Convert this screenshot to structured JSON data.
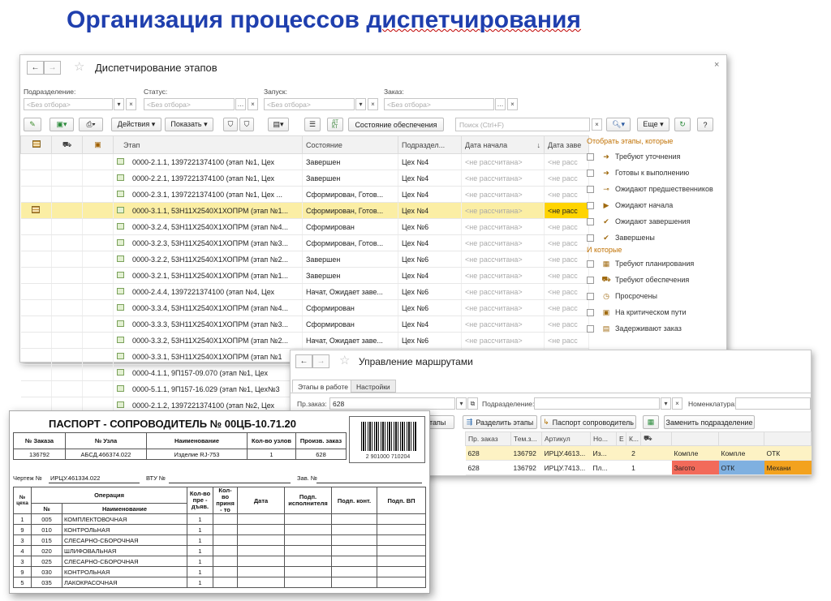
{
  "slide": {
    "title_a": "Организация процессов ",
    "title_b": "диспетчирования"
  },
  "win1": {
    "nav_back": "←",
    "nav_fwd": "→",
    "star": "☆",
    "title": "Диспетчирование этапов",
    "close": "×",
    "filters": [
      {
        "label": "Подразделение:",
        "placeholder": "<Без отбора>"
      },
      {
        "label": "Статус:",
        "placeholder": "<Без отбора>"
      },
      {
        "label": "Запуск:",
        "placeholder": "<Без отбора>"
      },
      {
        "label": "Заказ:",
        "placeholder": "<Без отбора>"
      }
    ],
    "toolbar": {
      "actions": "Действия ▾",
      "show": "Показать ▾",
      "supply_state": "Состояние обеспечения",
      "search_placeholder": "Поиск (Ctrl+F)",
      "more": "Еще ▾",
      "help": "?"
    },
    "columns": [
      "",
      "",
      "",
      "Этап",
      "Состояние",
      "Подраздел...",
      "Дата начала",
      "Дата заве"
    ],
    "sort_arrow": "↓",
    "rows": [
      {
        "stage": "0000-2.1.1, 1397221374100 (этап №1, Цех",
        "state": "Завершен",
        "dept": "Цех №4",
        "start": "<не рассчитана>",
        "end": "<не расс"
      },
      {
        "stage": "0000-2.2.1, 1397221374100 (этап №1, Цех",
        "state": "Завершен",
        "dept": "Цех №4",
        "start": "<не рассчитана>",
        "end": "<не расс"
      },
      {
        "stage": "0000-2.3.1, 1397221374100 (этап №1, Цех ...",
        "state": "Сформирован, Готов...",
        "dept": "Цех №4",
        "start": "<не рассчитана>",
        "end": "<не расс"
      },
      {
        "stage": "0000-3.1.1, 53Н11Х2540Х1ХОПРМ (этап №1...",
        "state": "Сформирован, Готов...",
        "dept": "Цех №4",
        "start": "<не рассчитана>",
        "end": "<не расс"
      },
      {
        "stage": "0000-3.2.4, 53Н11Х2540Х1ХОПРМ (этап №4...",
        "state": "Сформирован",
        "dept": "Цех №6",
        "start": "<не рассчитана>",
        "end": "<не расс"
      },
      {
        "stage": "0000-3.2.3, 53Н11Х2540Х1ХОПРМ (этап №3...",
        "state": "Сформирован, Готов...",
        "dept": "Цех №4",
        "start": "<не рассчитана>",
        "end": "<не расс"
      },
      {
        "stage": "0000-3.2.2, 53Н11Х2540Х1ХОПРМ (этап №2...",
        "state": "Завершен",
        "dept": "Цех №6",
        "start": "<не рассчитана>",
        "end": "<не расс"
      },
      {
        "stage": "0000-3.2.1, 53Н11Х2540Х1ХОПРМ (этап №1...",
        "state": "Завершен",
        "dept": "Цех №4",
        "start": "<не рассчитана>",
        "end": "<не расс"
      },
      {
        "stage": "0000-2.4.4, 1397221374100 (этап №4, Цех",
        "state": "Начат, Ожидает заве...",
        "dept": "Цех №6",
        "start": "<не рассчитана>",
        "end": "<не расс"
      },
      {
        "stage": "0000-3.3.4, 53Н11Х2540Х1ХОПРМ (этап №4...",
        "state": "Сформирован",
        "dept": "Цех №6",
        "start": "<не рассчитана>",
        "end": "<не расс"
      },
      {
        "stage": "0000-3.3.3, 53Н11Х2540Х1ХОПРМ (этап №3...",
        "state": "Сформирован",
        "dept": "Цех №4",
        "start": "<не рассчитана>",
        "end": "<не расс"
      },
      {
        "stage": "0000-3.3.2, 53Н11Х2540Х1ХОПРМ (этап №2...",
        "state": "Начат, Ожидает заве...",
        "dept": "Цех №6",
        "start": "<не рассчитана>",
        "end": "<не расс"
      },
      {
        "stage": "0000-3.3.1, 53Н11Х2540Х1ХОПРМ (этап №1",
        "state": "",
        "dept": "",
        "start": "",
        "end": ""
      },
      {
        "stage": "0000-4.1.1, 9П157-09.070 (этап №1, Цех",
        "state": "",
        "dept": "",
        "start": "",
        "end": ""
      },
      {
        "stage": "0000-5.1.1, 9П157-16.029 (этап №1, Цех№3",
        "state": "",
        "dept": "",
        "start": "",
        "end": ""
      },
      {
        "stage": "0000-2.1.2, 1397221374100 (этап №2, Цех",
        "state": "",
        "dept": "",
        "start": "",
        "end": ""
      }
    ],
    "selected_end": "<не расс",
    "side_panel": {
      "header1": "Отобрать этапы, которые",
      "items1": [
        {
          "icon": "➜",
          "label": "Требуют уточнения"
        },
        {
          "icon": "➜",
          "label": "Готовы к выполнению"
        },
        {
          "icon": "⊸",
          "label": "Ожидают предшественников"
        },
        {
          "icon": "▶",
          "label": "Ожидают начала"
        },
        {
          "icon": "✔",
          "label": "Ожидают завершения"
        },
        {
          "icon": "✔",
          "label": "Завершены"
        }
      ],
      "header2": "И которые",
      "items2": [
        {
          "icon": "▦",
          "label": "Требуют планирования"
        },
        {
          "icon": "⛟",
          "label": "Требуют обеспечения"
        },
        {
          "icon": "◷",
          "label": "Просрочены"
        },
        {
          "icon": "▣",
          "label": "На критическом пути"
        },
        {
          "icon": "▤",
          "label": "Задерживают заказ"
        }
      ]
    }
  },
  "win2": {
    "nav_back": "←",
    "nav_fwd": "→",
    "star": "☆",
    "title": "Управление маршрутами",
    "tabs": [
      "Этапы в работе",
      "Настройки"
    ],
    "order_label": "Пр.заказ:",
    "order_value": "628",
    "dept_label": "Подразделение:",
    "nom_label": "Номенклатура:",
    "buttons": [
      "этапы",
      "Разделить этапы",
      "Паспорт сопроводитель",
      "Заменить подразделение"
    ],
    "columns": [
      "Пр. заказ",
      "Тем.з...",
      "Артикул",
      "Но...",
      "Е",
      "К...",
      ""
    ],
    "rows": [
      {
        "order": "628",
        "tem": "136792",
        "art": "ИРЦУ.4613...",
        "no": "Из...",
        "e": "",
        "k": "2",
        "c1": "Компле",
        "c2": "Компле",
        "c3": "ОТК"
      },
      {
        "order": "628",
        "tem": "136792",
        "art": "ИРЦУ.7413...",
        "no": "Пл...",
        "e": "",
        "k": "1",
        "c1": "Загото",
        "c2": "ОТК",
        "c3": "Механи"
      }
    ]
  },
  "passport": {
    "title": "ПАСПОРТ - СОПРОВОДИТЕЛЬ № 00ЦБ-10.71.20",
    "head_cols": [
      "№ Заказа",
      "№ Узла",
      "Наименование",
      "Кол-во узлов",
      "Произв. заказ"
    ],
    "head_vals": [
      "136792",
      "АБСД.466374.022",
      "Изделие RJ-753",
      "1",
      "628"
    ],
    "barcode_num": "2 901000 710204",
    "drawing_label": "Чертеж №",
    "drawing_value": "ИРЦУ.461334.022",
    "vtu_label": "ВТУ №",
    "zav_label": "Зав. №",
    "ops_cols": [
      "№ цеха",
      "Операция",
      "Кол-во пре - дъяв.",
      "Кол-во приня - то",
      "Дата",
      "Подп. исполнителя",
      "Подп. конт.",
      "Подп. ВП"
    ],
    "ops_sub": [
      "№",
      "Наименование"
    ],
    "ops": [
      {
        "shop": "1",
        "no": "005",
        "name": "КОМПЛЕКТОВОЧНАЯ",
        "qty": "1"
      },
      {
        "shop": "9",
        "no": "010",
        "name": "КОНТРОЛЬНАЯ",
        "qty": "1"
      },
      {
        "shop": "3",
        "no": "015",
        "name": "СЛЕСАРНО-СБОРОЧНАЯ",
        "qty": "1"
      },
      {
        "shop": "4",
        "no": "020",
        "name": "ШЛИФОВАЛЬНАЯ",
        "qty": "1"
      },
      {
        "shop": "3",
        "no": "025",
        "name": "СЛЕСАРНО-СБОРОЧНАЯ",
        "qty": "1"
      },
      {
        "shop": "9",
        "no": "030",
        "name": "КОНТРОЛЬНАЯ",
        "qty": "1"
      },
      {
        "shop": "5",
        "no": "035",
        "name": "ЛАКОКРАСОЧНАЯ",
        "qty": "1"
      }
    ]
  }
}
